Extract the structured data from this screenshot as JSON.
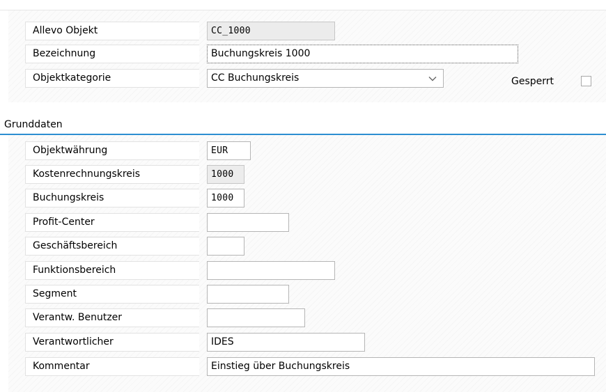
{
  "header": {
    "fields": [
      {
        "label": "Allevo Objekt",
        "value": "CC_1000"
      },
      {
        "label": "Bezeichnung",
        "value": "Buchungskreis 1000"
      },
      {
        "label": "Objektkategorie",
        "value": "CC Buchungskreis"
      }
    ],
    "gesperrt_label": "Gesperrt",
    "gesperrt_checked": false
  },
  "section": {
    "title": "Grunddaten",
    "accent_color": "#2c8ed1",
    "fields": [
      {
        "label": "Objektwährung",
        "value": "EUR"
      },
      {
        "label": "Kostenrechnungskreis",
        "value": "1000"
      },
      {
        "label": "Buchungskreis",
        "value": "1000"
      },
      {
        "label": "Profit-Center",
        "value": ""
      },
      {
        "label": "Geschäftsbereich",
        "value": ""
      },
      {
        "label": "Funktionsbereich",
        "value": ""
      },
      {
        "label": "Segment",
        "value": ""
      },
      {
        "label": "Verantw. Benutzer",
        "value": ""
      },
      {
        "label": "Verantwortlicher",
        "value": "IDES"
      },
      {
        "label": "Kommentar",
        "value": "Einstieg über Buchungskreis"
      }
    ]
  },
  "icons": {
    "dropdown": "chevron-down-icon"
  }
}
